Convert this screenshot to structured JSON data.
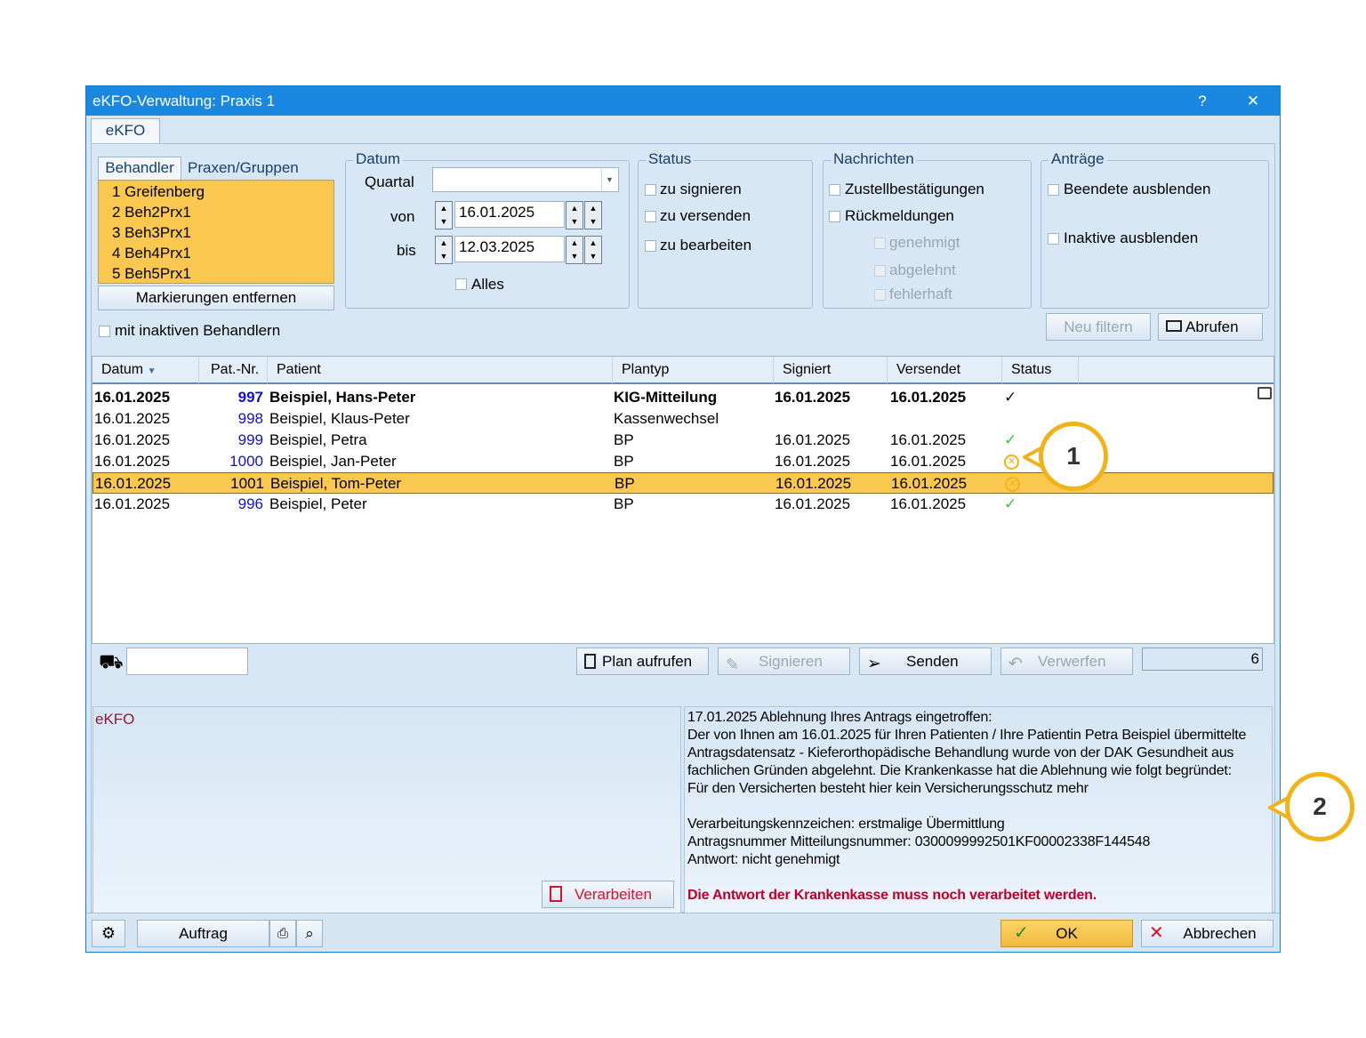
{
  "window": {
    "title": "eKFO-Verwaltung: Praxis 1",
    "help_label": "?",
    "close_label": "✕"
  },
  "tabs": {
    "main": "eKFO"
  },
  "behandler": {
    "tab_behandler": "Behandler",
    "tab_praxen": "Praxen/Gruppen",
    "items": [
      "1 Greifenberg",
      "2 Beh2Prx1",
      "3 Beh3Prx1",
      "4 Beh4Prx1",
      "5 Beh5Prx1"
    ],
    "clear_button": "Markierungen entfernen",
    "inactive_label": "mit inaktiven Behandlern"
  },
  "datum": {
    "title": "Datum",
    "quartal_label": "Quartal",
    "quartal_value": "",
    "von_label": "von",
    "von_value": "16.01.2025",
    "bis_label": "bis",
    "bis_value": "12.03.2025",
    "alles_label": "Alles"
  },
  "status": {
    "title": "Status",
    "items": [
      "zu signieren",
      "zu versenden",
      "zu bearbeiten"
    ]
  },
  "nachrichten": {
    "title": "Nachrichten",
    "zustell": "Zustellbestätigungen",
    "rueck": "Rückmeldungen",
    "genehmigt": "genehmigt",
    "abgelehnt": "abgelehnt",
    "fehlerhaft": "fehlerhaft"
  },
  "antraege": {
    "title": "Anträge",
    "beendete": "Beendete ausblenden",
    "inaktive": "Inaktive ausblenden"
  },
  "filter_buttons": {
    "neu_filtern": "Neu filtern",
    "abrufen": "Abrufen"
  },
  "table": {
    "columns": {
      "datum": "Datum",
      "patnr": "Pat.-Nr.",
      "patient": "Patient",
      "plantyp": "Plantyp",
      "signiert": "Signiert",
      "versendet": "Versendet",
      "status": "Status"
    },
    "rows": [
      {
        "datum": "16.01.2025",
        "patnr": "997",
        "patient": "Beispiel, Hans-Peter",
        "plantyp": "KIG-Mitteilung",
        "signiert": "16.01.2025",
        "versendet": "16.01.2025",
        "status_icon": "check-black-icon"
      },
      {
        "datum": "16.01.2025",
        "patnr": "998",
        "patient": "Beispiel, Klaus-Peter",
        "plantyp": "Kassenwechsel",
        "signiert": "",
        "versendet": "",
        "status_icon": ""
      },
      {
        "datum": "16.01.2025",
        "patnr": "999",
        "patient": "Beispiel, Petra",
        "plantyp": "BP",
        "signiert": "16.01.2025",
        "versendet": "16.01.2025",
        "status_icon": "check-green-icon"
      },
      {
        "datum": "16.01.2025",
        "patnr": "1000",
        "patient": "Beispiel, Jan-Peter",
        "plantyp": "BP",
        "signiert": "16.01.2025",
        "versendet": "16.01.2025",
        "status_icon": "rejected-circle-icon"
      },
      {
        "datum": "16.01.2025",
        "patnr": "1001",
        "patient": "Beispiel, Tom-Peter",
        "plantyp": "BP",
        "signiert": "16.01.2025",
        "versendet": "16.01.2025",
        "status_icon": "rejected-circle-icon"
      },
      {
        "datum": "16.01.2025",
        "patnr": "996",
        "patient": "Beispiel, Peter",
        "plantyp": "BP",
        "signiert": "16.01.2025",
        "versendet": "16.01.2025",
        "status_icon": "check-green-icon"
      }
    ],
    "count": "6"
  },
  "actions": {
    "search_value": "",
    "plan_aufrufen": "Plan aufrufen",
    "signieren": "Signieren",
    "senden": "Senden",
    "verwerfen": "Verwerfen"
  },
  "message": {
    "left_title": "eKFO",
    "verarbeiten": "Verarbeiten",
    "lines": [
      "17.01.2025 Ablehnung Ihres Antrags eingetroffen:",
      "Der von Ihnen am 16.01.2025 für Ihren Patienten / Ihre Patientin Petra Beispiel übermittelte",
      "Antragsdatensatz - Kieferorthopädische Behandlung wurde von der DAK Gesundheit aus",
      "fachlichen Gründen abgelehnt. Die Krankenkasse hat die Ablehnung wie folgt begründet:",
      "Für den Versicherten besteht hier kein Versicherungsschutz mehr",
      "",
      "Verarbeitungskennzeichen: erstmalige Übermittlung",
      "Antragsnummer Mitteilungsnummer: 0300099992501KF00002338F144548",
      "Antwort: nicht genehmigt"
    ],
    "warning": "Die Antwort der Krankenkasse muss noch verarbeitet werden."
  },
  "bottom": {
    "auftrag": "Auftrag",
    "ok": "OK",
    "abbrechen": "Abbrechen"
  },
  "callouts": [
    "1",
    "2"
  ],
  "colors": {
    "accent": "#f0b41a",
    "selection": "#fac84f",
    "titlebar": "#1a88e0",
    "warning": "#c0002a"
  }
}
